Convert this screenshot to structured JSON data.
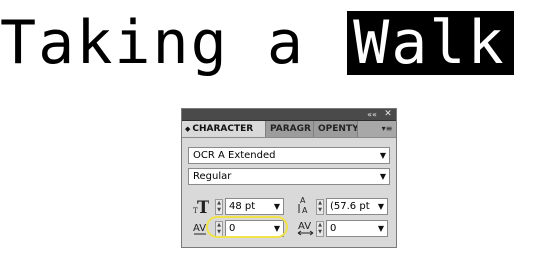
{
  "headline": {
    "plain_text": "Taking a ",
    "highlighted_text": "Walk"
  },
  "panel": {
    "tabs": [
      {
        "label": "CHARACTER",
        "active": true
      },
      {
        "label": "PARAGR",
        "active": false
      },
      {
        "label": "OPENTY",
        "active": false
      }
    ],
    "font_family": "OCR A Extended",
    "font_style": "Regular",
    "font_size": "48 pt",
    "leading": "(57.6 pt",
    "kerning": "0",
    "tracking": "0"
  },
  "icons": {
    "collapse": "double-chevron-icon",
    "close": "close-icon",
    "panel_menu": "panel-menu-icon",
    "font_size": "font-size-icon",
    "leading": "leading-icon",
    "kerning": "kerning-icon",
    "tracking": "tracking-icon"
  },
  "colors": {
    "highlight_ring": "#f2e24a",
    "inverted_bg": "#000000"
  }
}
